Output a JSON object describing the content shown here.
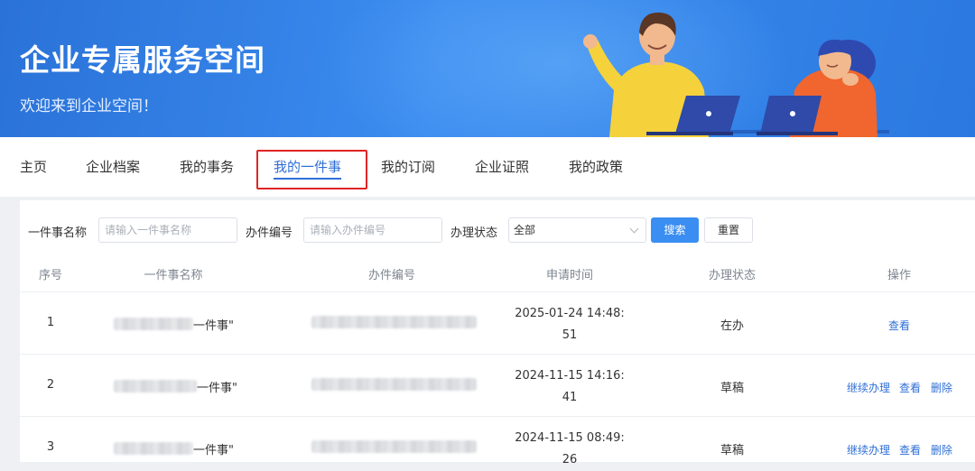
{
  "banner": {
    "title": "企业专属服务空间",
    "subtitle": "欢迎来到企业空间！"
  },
  "tabs": [
    {
      "label": "主页"
    },
    {
      "label": "企业档案"
    },
    {
      "label": "我的事务"
    },
    {
      "label": "我的一件事",
      "active": true
    },
    {
      "label": "我的订阅"
    },
    {
      "label": "企业证照"
    },
    {
      "label": "我的政策"
    }
  ],
  "filters": {
    "name_label": "一件事名称",
    "name_placeholder": "请输入一件事名称",
    "code_label": "办件编号",
    "code_placeholder": "请输入办件编号",
    "status_label": "办理状态",
    "status_value": "全部",
    "search_label": "搜索",
    "reset_label": "重置"
  },
  "table": {
    "headers": [
      "序号",
      "一件事名称",
      "办件编号",
      "申请时间",
      "办理状态",
      "操作"
    ],
    "rows": [
      {
        "index": "1",
        "name_suffix": "一件事\"",
        "time_line1": "2025-01-24 14:48:",
        "time_line2": "51",
        "status": "在办",
        "actions": [
          "查看"
        ]
      },
      {
        "index": "2",
        "name_suffix": "一件事\"",
        "time_line1": "2024-11-15 14:16:",
        "time_line2": "41",
        "status": "草稿",
        "actions": [
          "继续办理",
          "查看",
          "删除"
        ]
      },
      {
        "index": "3",
        "name_suffix": "一件事\"",
        "time_line1": "2024-11-15 08:49:",
        "time_line2": "26",
        "status": "草稿",
        "actions": [
          "继续办理",
          "查看",
          "删除"
        ]
      }
    ]
  },
  "colors": {
    "accent": "#2f6fd6",
    "banner": "#3b8cf0",
    "highlight_box": "#e02424"
  }
}
